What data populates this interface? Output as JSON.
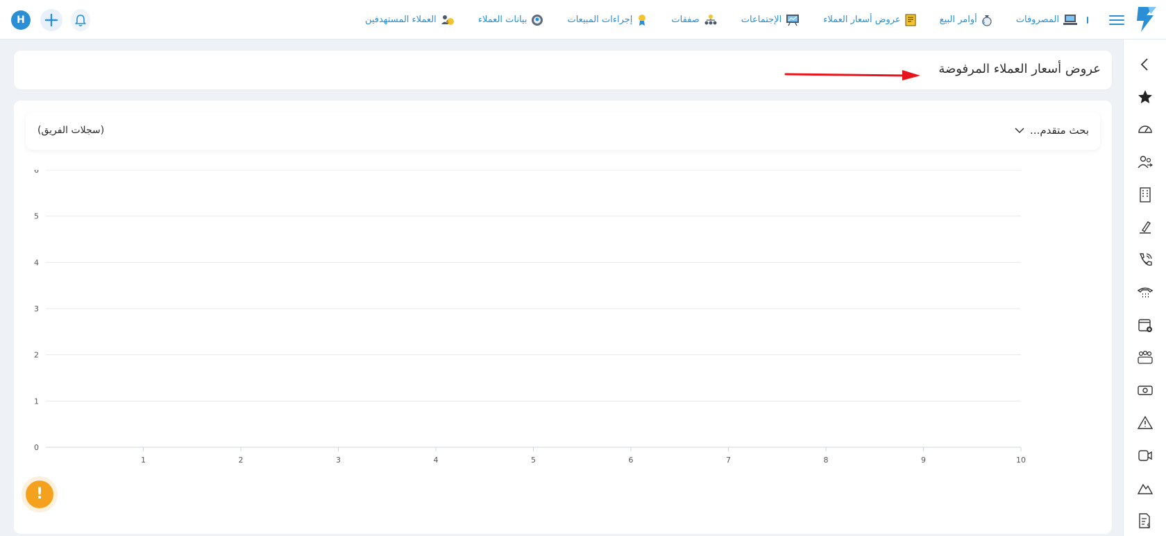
{
  "header": {
    "avatar_initial": "H",
    "nav_items": [
      {
        "label": "العملاء المستهدفين",
        "icon": "target-customers-icon"
      },
      {
        "label": "بيانات العملاء",
        "icon": "customer-data-icon"
      },
      {
        "label": "إجراءات المبيعات",
        "icon": "sales-actions-icon"
      },
      {
        "label": "صفقات",
        "icon": "deals-icon"
      },
      {
        "label": "الإجتماعات",
        "icon": "meetings-icon"
      },
      {
        "label": "عروض أسعار العملاء",
        "icon": "quotes-icon"
      },
      {
        "label": "أوامر البيع",
        "icon": "sales-orders-icon"
      },
      {
        "label": "المصروفات",
        "icon": "expenses-icon"
      }
    ]
  },
  "page": {
    "title": "عروض أسعار العملاء المرفوضة"
  },
  "filter": {
    "advanced_search": "بحث متقدم...",
    "team_records": "(سجلات الفريق)"
  },
  "colors": {
    "accent": "#2b8fd6",
    "arrow": "#e8141c",
    "fab": "#f4a21e"
  },
  "chart_data": {
    "type": "line",
    "x_ticks": [
      "1",
      "2",
      "3",
      "4",
      "5",
      "6",
      "7",
      "8",
      "9",
      "10"
    ],
    "y_ticks": [
      "0",
      "1",
      "2",
      "3",
      "4",
      "5",
      "6"
    ],
    "xlim": [
      0,
      10
    ],
    "ylim": [
      0,
      6
    ],
    "series": [],
    "grid": true
  }
}
